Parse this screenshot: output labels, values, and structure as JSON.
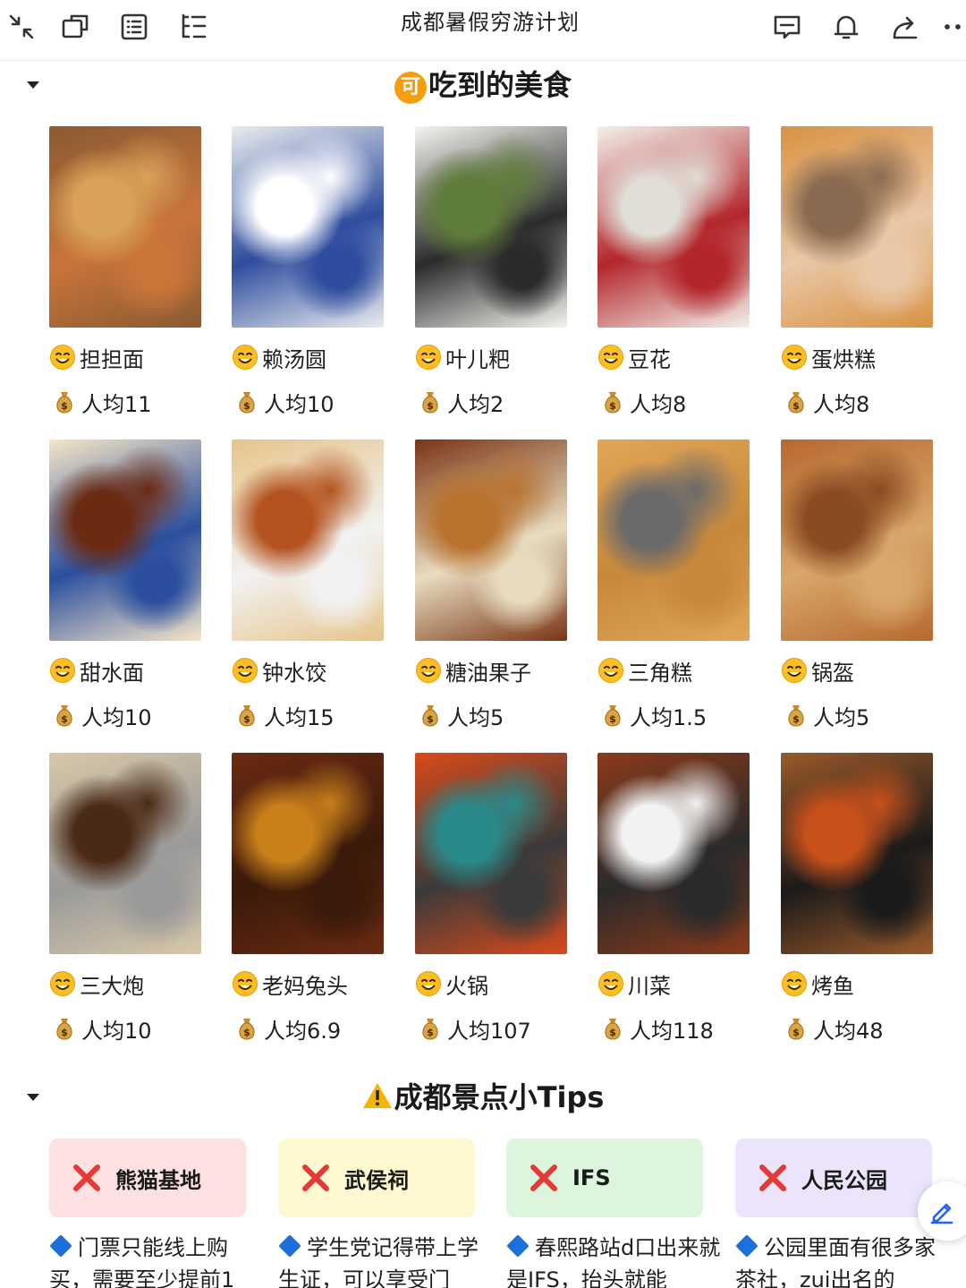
{
  "toolbar": {
    "title": "成都暑假穷游计划",
    "icons": [
      "collapse-arrows-icon",
      "window-icon",
      "outline-list-icon",
      "tree-list-icon",
      "comment-icon",
      "bell-icon",
      "share-icon",
      "more-icon"
    ]
  },
  "food_section": {
    "badge": "可",
    "title": "吃到的美食",
    "items": [
      {
        "name": "担担面",
        "price": "人均11",
        "photo_colors": [
          "#8a5a32",
          "#d9a25a",
          "#c9753a"
        ]
      },
      {
        "name": "赖汤圆",
        "price": "人均10",
        "photo_colors": [
          "#e9ecef",
          "#ffffff",
          "#2f4d9e"
        ]
      },
      {
        "name": "叶儿粑",
        "price": "人均2",
        "photo_colors": [
          "#f4f4f0",
          "#5f7d3a",
          "#2b2b2b"
        ]
      },
      {
        "name": "豆花",
        "price": "人均8",
        "photo_colors": [
          "#f3f1ea",
          "#e0ded6",
          "#b3262c"
        ]
      },
      {
        "name": "蛋烘糕",
        "price": "人均8",
        "photo_colors": [
          "#d99242",
          "#8a6a50",
          "#e9c8a8"
        ]
      },
      {
        "name": "甜水面",
        "price": "人均10",
        "photo_colors": [
          "#f5e6c8",
          "#6b2a12",
          "#2b4f9e"
        ]
      },
      {
        "name": "钟水饺",
        "price": "人均15",
        "photo_colors": [
          "#e6c48a",
          "#b4531f",
          "#f2f2f2"
        ]
      },
      {
        "name": "糖油果子",
        "price": "人均5",
        "photo_colors": [
          "#7a3515",
          "#b9732f",
          "#e8dcc0"
        ]
      },
      {
        "name": "三角糕",
        "price": "人均1.5",
        "photo_colors": [
          "#e2a658",
          "#6a6a6a",
          "#c7883c"
        ]
      },
      {
        "name": "锅盔",
        "price": "人均5",
        "photo_colors": [
          "#b7692f",
          "#8a4a22",
          "#d8a76a"
        ]
      },
      {
        "name": "三大炮",
        "price": "人均10",
        "photo_colors": [
          "#d8c8a8",
          "#4a2a16",
          "#9a9a9a"
        ]
      },
      {
        "name": "老妈兔头",
        "price": "人均6.9",
        "photo_colors": [
          "#6a2a12",
          "#c8801a",
          "#3a1a0a"
        ]
      },
      {
        "name": "火锅",
        "price": "人均107",
        "photo_colors": [
          "#d94a1a",
          "#2a8a8a",
          "#3a3a3a"
        ]
      },
      {
        "name": "川菜",
        "price": "人均118",
        "photo_colors": [
          "#8a3a1a",
          "#f2f2f2",
          "#2a2a2a"
        ]
      },
      {
        "name": "烤鱼",
        "price": "人均48",
        "photo_colors": [
          "#9a5a2a",
          "#c8501a",
          "#1a1a1a"
        ]
      }
    ]
  },
  "tips_section": {
    "title": "成都景点小Tips",
    "cards": [
      {
        "label": "熊猫基地",
        "bg": "#fde1e1",
        "text": "门票只能线上购买，需要至少提前1"
      },
      {
        "label": "武侯祠",
        "bg": "#fdf8cf",
        "text": "学生党记得带上学生证，可以享受门"
      },
      {
        "label": "IFS",
        "bg": "#dcf5dc",
        "text": "春熙路站d口出来就是IFS，抬头就能"
      },
      {
        "label": "人民公园",
        "bg": "#ebe4fa",
        "text": "公园里面有很多家茶社，zui出名的"
      }
    ]
  },
  "colors": {
    "accent_blue": "#1e6fd9",
    "x_red": "#e53935",
    "badge_orange": "#f59e0b"
  },
  "fab": {
    "icon": "edit-pencil-icon"
  }
}
